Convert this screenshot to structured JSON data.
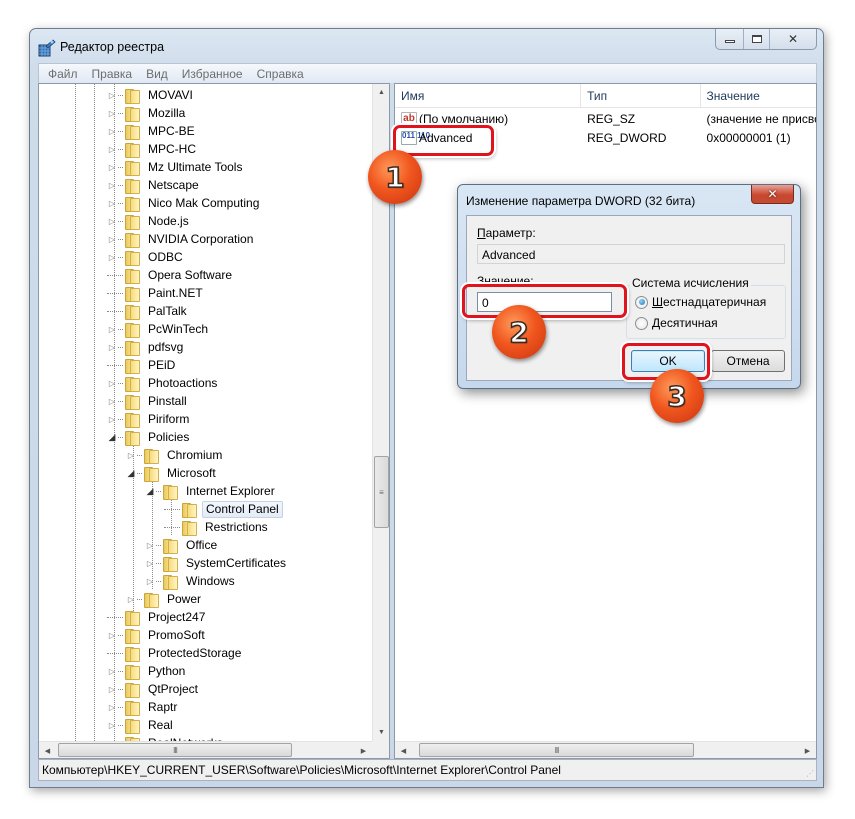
{
  "window": {
    "title": "Редактор реестра",
    "caption_buttons": {
      "minimize": "—",
      "maximize": "▫",
      "close": "✕"
    }
  },
  "menubar": {
    "items": [
      {
        "label": "Файл"
      },
      {
        "label": "Правка"
      },
      {
        "label": "Вид"
      },
      {
        "label": "Избранное"
      },
      {
        "label": "Справка"
      }
    ]
  },
  "tree": {
    "items": [
      {
        "label": "MOVAVI",
        "level": 0,
        "expander": "collapsed"
      },
      {
        "label": "Mozilla",
        "level": 0,
        "expander": "collapsed"
      },
      {
        "label": "MPC-BE",
        "level": 0,
        "expander": "collapsed"
      },
      {
        "label": "MPC-HC",
        "level": 0,
        "expander": "collapsed"
      },
      {
        "label": "Mz Ultimate Tools",
        "level": 0,
        "expander": "collapsed"
      },
      {
        "label": "Netscape",
        "level": 0,
        "expander": "collapsed"
      },
      {
        "label": "Nico Mak Computing",
        "level": 0,
        "expander": "collapsed"
      },
      {
        "label": "Node.js",
        "level": 0,
        "expander": "collapsed"
      },
      {
        "label": "NVIDIA Corporation",
        "level": 0,
        "expander": "collapsed"
      },
      {
        "label": "ODBC",
        "level": 0,
        "expander": "collapsed"
      },
      {
        "label": "Opera Software",
        "level": 0,
        "expander": "none"
      },
      {
        "label": "Paint.NET",
        "level": 0,
        "expander": "none"
      },
      {
        "label": "PalTalk",
        "level": 0,
        "expander": "none"
      },
      {
        "label": "PcWinTech",
        "level": 0,
        "expander": "collapsed"
      },
      {
        "label": "pdfsvg",
        "level": 0,
        "expander": "collapsed"
      },
      {
        "label": "PEiD",
        "level": 0,
        "expander": "none"
      },
      {
        "label": "Photoactions",
        "level": 0,
        "expander": "collapsed"
      },
      {
        "label": "Pinstall",
        "level": 0,
        "expander": "collapsed"
      },
      {
        "label": "Piriform",
        "level": 0,
        "expander": "collapsed"
      },
      {
        "label": "Policies",
        "level": 0,
        "expander": "expanded"
      },
      {
        "label": "Chromium",
        "level": 1,
        "expander": "collapsed"
      },
      {
        "label": "Microsoft",
        "level": 1,
        "expander": "expanded"
      },
      {
        "label": "Internet Explorer",
        "level": 2,
        "expander": "expanded"
      },
      {
        "label": "Control Panel",
        "level": 3,
        "expander": "none",
        "selected": true
      },
      {
        "label": "Restrictions",
        "level": 3,
        "expander": "none"
      },
      {
        "label": "Office",
        "level": 2,
        "expander": "collapsed"
      },
      {
        "label": "SystemCertificates",
        "level": 2,
        "expander": "collapsed"
      },
      {
        "label": "Windows",
        "level": 2,
        "expander": "collapsed"
      },
      {
        "label": "Power",
        "level": 1,
        "expander": "collapsed"
      },
      {
        "label": "Project247",
        "level": 0,
        "expander": "none"
      },
      {
        "label": "PromoSoft",
        "level": 0,
        "expander": "collapsed"
      },
      {
        "label": "ProtectedStorage",
        "level": 0,
        "expander": "none"
      },
      {
        "label": "Python",
        "level": 0,
        "expander": "collapsed"
      },
      {
        "label": "QtProject",
        "level": 0,
        "expander": "collapsed"
      },
      {
        "label": "Raptr",
        "level": 0,
        "expander": "collapsed"
      },
      {
        "label": "Real",
        "level": 0,
        "expander": "collapsed"
      },
      {
        "label": "RealNetworks",
        "level": 0,
        "expander": "collapsed"
      }
    ],
    "scrollbar_grip": "≡",
    "hscroll_grip": "III"
  },
  "values": {
    "columns": [
      {
        "label": "Имя"
      },
      {
        "label": "Тип"
      },
      {
        "label": "Значение"
      }
    ],
    "rows": [
      {
        "icon": "string-value-icon",
        "icon_text": "ab",
        "name": "(По умолчанию)",
        "type": "REG_SZ",
        "value": "(значение не присвоено)"
      },
      {
        "icon": "binary-value-icon",
        "icon_text": "011 110",
        "name": "Advanced",
        "type": "REG_DWORD",
        "value": "0x00000001 (1)"
      }
    ],
    "hscroll_grip": "III"
  },
  "statusbar": {
    "path": "Компьютер\\HKEY_CURRENT_USER\\Software\\Policies\\Microsoft\\Internet Explorer\\Control Panel"
  },
  "dialog": {
    "title": "Изменение параметра DWORD (32 бита)",
    "close_label": "✕",
    "param_label_u": "П",
    "param_label_rest": "араметр:",
    "param_value": "Advanced",
    "value_label_u": "З",
    "value_label_rest": "начение:",
    "value_input": "0",
    "radix_group_label": "Система исчисления",
    "radix_options": [
      {
        "u": "Ш",
        "rest": "естнадцатеричная",
        "checked": true
      },
      {
        "u": "Д",
        "rest": "есятичная",
        "checked": false
      }
    ],
    "ok_label": "OK",
    "cancel_label": "Отмена"
  },
  "annotations": {
    "markers": [
      {
        "label": "1"
      },
      {
        "label": "2"
      },
      {
        "label": "3"
      }
    ],
    "accent_color": "#e0141c",
    "marker_color": "#f0561e"
  }
}
